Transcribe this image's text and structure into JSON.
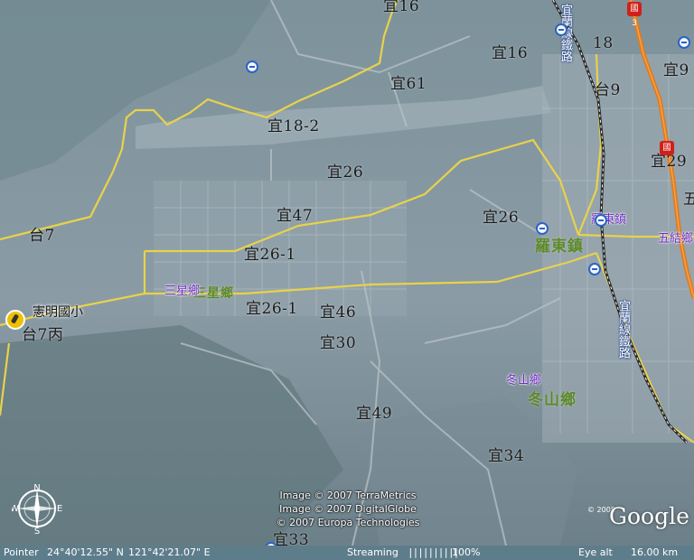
{
  "map": {
    "road_labels": [
      {
        "id": "yi16-top",
        "text": "宜16"
      },
      {
        "id": "yi16",
        "text": "宜16"
      },
      {
        "id": "yi18",
        "text": "18"
      },
      {
        "id": "yi9",
        "text": "宜9"
      },
      {
        "id": "yi61",
        "text": "宜61"
      },
      {
        "id": "tai9",
        "text": "台9"
      },
      {
        "id": "yi18-2",
        "text": "宜18-2"
      },
      {
        "id": "yi26-a",
        "text": "宜26"
      },
      {
        "id": "yi29",
        "text": "宜29"
      },
      {
        "id": "yi47",
        "text": "宜47"
      },
      {
        "id": "yi26-b",
        "text": "宜26"
      },
      {
        "id": "tai7",
        "text": "台7"
      },
      {
        "id": "yi26-1-a",
        "text": "宜26-1"
      },
      {
        "id": "yi26-1-b",
        "text": "宜26-1"
      },
      {
        "id": "yi46",
        "text": "宜46"
      },
      {
        "id": "tai7bing",
        "text": "台7丙"
      },
      {
        "id": "yi30",
        "text": "宜30"
      },
      {
        "id": "yi49",
        "text": "宜49"
      },
      {
        "id": "yi34",
        "text": "宜34"
      },
      {
        "id": "yi33",
        "text": "宜33"
      }
    ],
    "town_labels": [
      {
        "id": "luodong",
        "text": "羅東鎮"
      },
      {
        "id": "sanxing",
        "text": "三星鄉"
      },
      {
        "id": "dongshan",
        "text": "冬山鄉"
      }
    ],
    "small_labels": [
      {
        "id": "luodong-small",
        "text": "羅東鎮"
      },
      {
        "id": "wujie-small",
        "text": "五結鄉"
      },
      {
        "id": "sanxing-small",
        "text": "三星鄉"
      },
      {
        "id": "dongshan-small",
        "text": "冬山鄉"
      }
    ],
    "rail_labels": [
      {
        "id": "rail-top",
        "text": "宜蘭線鐵路"
      },
      {
        "id": "rail-bottom",
        "text": "宜蘭線鐵路"
      }
    ],
    "school": {
      "text": "憲明國小"
    },
    "shield_labels": {
      "top": "國 3",
      "mid": "國"
    },
    "edge_text": {
      "right": "五"
    },
    "copyright": [
      "Image © 2007 TerraMetrics",
      "Image © 2007 DigitalGlobe",
      "© 2007 Europa Technologies"
    ],
    "brand": "Google",
    "brand_year": "© 2005",
    "compass_letters": {
      "n": "N",
      "s": "S",
      "e": "E",
      "w": "W"
    },
    "colors": {
      "road": "#e8d24a",
      "highway": "#e07b1e",
      "rail": "#2b2b2b",
      "town": "#5d8a2a",
      "poi": "#6f2fc0"
    }
  },
  "status": {
    "pointer_label": "Pointer",
    "pointer_lat": "24°40'12.55\" N",
    "pointer_lon": "121°42'21.07\" E",
    "streaming_label": "Streaming",
    "streaming_bars": "||||||||||",
    "streaming_pct": "100%",
    "eye_label": "Eye alt",
    "eye_value": "16.00 km"
  }
}
